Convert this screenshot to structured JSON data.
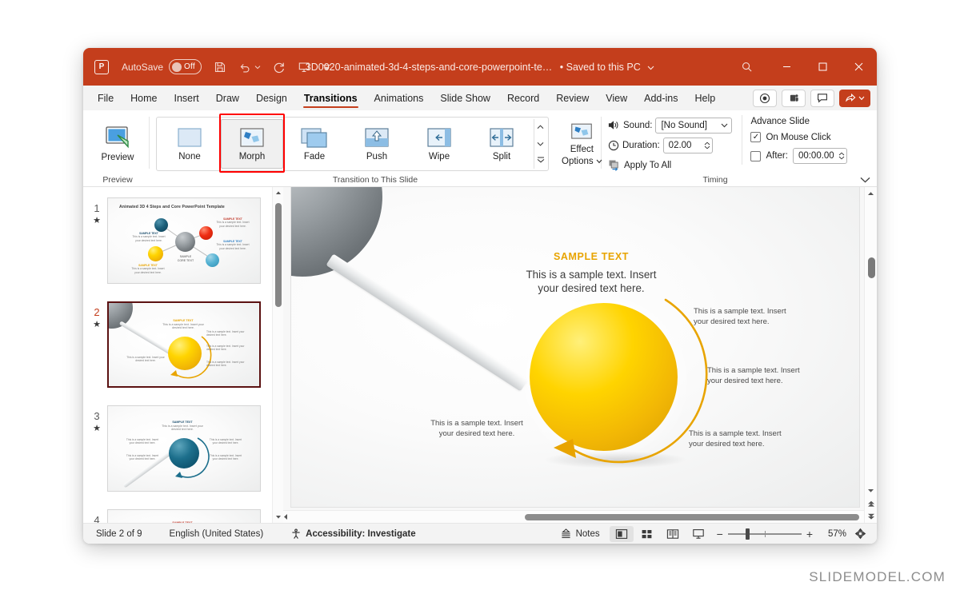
{
  "titlebar": {
    "app_icon": "powerpoint-logo",
    "autosave_label": "AutoSave",
    "autosave_state": "Off",
    "save_icon": "save-icon",
    "undo_icon": "undo-icon",
    "redo_icon": "redo-icon",
    "present_icon": "start-presentation-icon",
    "customize_icon": "customize-quick-access-icon",
    "document_title": "3D0020-animated-3d-4-steps-and-core-powerpoint-te…",
    "save_status": "• Saved to this PC",
    "search_icon": "search-icon",
    "minimize": "minimize-icon",
    "maximize": "maximize-icon",
    "close": "close-icon",
    "accent_color": "#c43e1c"
  },
  "tabs": [
    {
      "label": "File",
      "active": false
    },
    {
      "label": "Home",
      "active": false
    },
    {
      "label": "Insert",
      "active": false
    },
    {
      "label": "Draw",
      "active": false
    },
    {
      "label": "Design",
      "active": false
    },
    {
      "label": "Transitions",
      "active": true
    },
    {
      "label": "Animations",
      "active": false
    },
    {
      "label": "Slide Show",
      "active": false
    },
    {
      "label": "Record",
      "active": false
    },
    {
      "label": "Review",
      "active": false
    },
    {
      "label": "View",
      "active": false
    },
    {
      "label": "Add-ins",
      "active": false
    },
    {
      "label": "Help",
      "active": false
    }
  ],
  "tabs_right": {
    "record_icon": "record-circle-icon",
    "teams_icon": "present-in-teams-icon",
    "comments_icon": "comments-icon",
    "share_label": "Share",
    "share_icon": "share-icon",
    "share_caret": "chevron-down-icon"
  },
  "ribbon": {
    "preview_group": {
      "button_label": "Preview",
      "group_label": "Preview",
      "icon": "preview-play-icon"
    },
    "transition_group": {
      "group_label": "Transition to This Slide",
      "items": [
        {
          "label": "None",
          "icon": "transition-none-icon",
          "selected": false
        },
        {
          "label": "Morph",
          "icon": "transition-morph-icon",
          "selected": true
        },
        {
          "label": "Fade",
          "icon": "transition-fade-icon",
          "selected": false
        },
        {
          "label": "Push",
          "icon": "transition-push-icon",
          "selected": false
        },
        {
          "label": "Wipe",
          "icon": "transition-wipe-icon",
          "selected": false
        },
        {
          "label": "Split",
          "icon": "transition-split-icon",
          "selected": false
        }
      ],
      "scroll_up": "chevron-up-icon",
      "scroll_down": "chevron-down-icon",
      "more": "more-transitions-icon",
      "effect_options_label": "Effect\nOptions",
      "effect_options_line1": "Effect",
      "effect_options_line2": "Options",
      "effect_options_caret": "chevron-down-icon"
    },
    "timing_group": {
      "group_label": "Timing",
      "sound_icon": "sound-icon",
      "sound_label": "Sound:",
      "sound_value": "[No Sound]",
      "sound_caret": "chevron-down-icon",
      "duration_icon": "clock-icon",
      "duration_label": "Duration:",
      "duration_value": "02.00",
      "apply_to_all_icon": "apply-to-all-icon",
      "apply_to_all_label": "Apply To All",
      "advance_slide_label": "Advance Slide",
      "on_mouse_click_label": "On Mouse Click",
      "on_mouse_click_checked": true,
      "after_label": "After:",
      "after_checked": false,
      "after_value": "00:00.00"
    },
    "collapse_icon": "chevron-down-icon"
  },
  "thumbnails": {
    "slides": [
      {
        "number": "1",
        "active": false,
        "star": "★",
        "title": "Animated 3D 4 Steps and Core PowerPoint Template"
      },
      {
        "number": "2",
        "active": true,
        "star": "★",
        "title": ""
      },
      {
        "number": "3",
        "active": false,
        "star": "★",
        "title": ""
      },
      {
        "number": "4",
        "active": false,
        "star": "★",
        "title": ""
      }
    ]
  },
  "slide": {
    "heading": "SAMPLE TEXT",
    "subheading_line1": "This is a sample text. Insert",
    "subheading_line2": "your desired text here.",
    "body_line1": "This is a sample text. Insert",
    "body_line2": "your desired text here.",
    "callouts": [
      {
        "line1": "This is a sample text. Insert",
        "line2": "your desired text here."
      },
      {
        "line1": "This is a sample text. Insert",
        "line2": "your desired text here."
      },
      {
        "line1": "This is a sample text. Insert",
        "line2": "your desired text here."
      },
      {
        "line1": "This is a sample text. Insert",
        "line2": "your desired text here."
      }
    ],
    "accent_color": "#e8a400",
    "ball_color": "#ffd400"
  },
  "statusbar": {
    "slide_counter": "Slide 2 of 9",
    "language": "English (United States)",
    "accessibility_icon": "accessibility-icon",
    "accessibility": "Accessibility: Investigate",
    "notes_icon": "notes-icon",
    "notes_label": "Notes",
    "views": [
      {
        "name": "normal-view",
        "icon": "normal-view-icon",
        "active": true
      },
      {
        "name": "slide-sorter-view",
        "icon": "slide-sorter-icon",
        "active": false
      },
      {
        "name": "reading-view",
        "icon": "reading-view-icon",
        "active": false
      },
      {
        "name": "slide-show-view",
        "icon": "slide-show-icon",
        "active": false
      }
    ],
    "zoom_out": "−",
    "zoom_in": "+",
    "zoom_level": "57%",
    "fit_icon": "fit-to-window-icon"
  },
  "watermark": "SLIDEMODEL.COM"
}
